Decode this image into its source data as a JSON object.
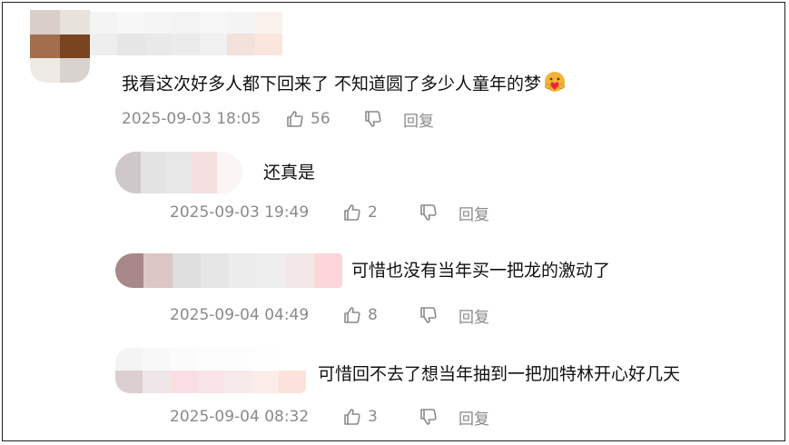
{
  "colors": {
    "text": "#111111",
    "meta": "#8a8a8a",
    "border": "#222222"
  },
  "comments": [
    {
      "text": "我看这次好多人都下回来了 不知道圆了多少人童年的梦",
      "emoji": "heart-hug-emoji",
      "time": "2025-09-03 18:05",
      "likes": "56",
      "reply_label": "回复"
    },
    {
      "text": "还真是",
      "time": "2025-09-03 19:49",
      "likes": "2",
      "reply_label": "回复"
    },
    {
      "text": "可惜也没有当年买一把龙的激动了",
      "time": "2025-09-04 04:49",
      "likes": "8",
      "reply_label": "回复"
    },
    {
      "text": "可惜回不去了想当年抽到一把加特林开心好几天",
      "time": "2025-09-04 08:32",
      "likes": "3",
      "reply_label": "回复"
    }
  ]
}
